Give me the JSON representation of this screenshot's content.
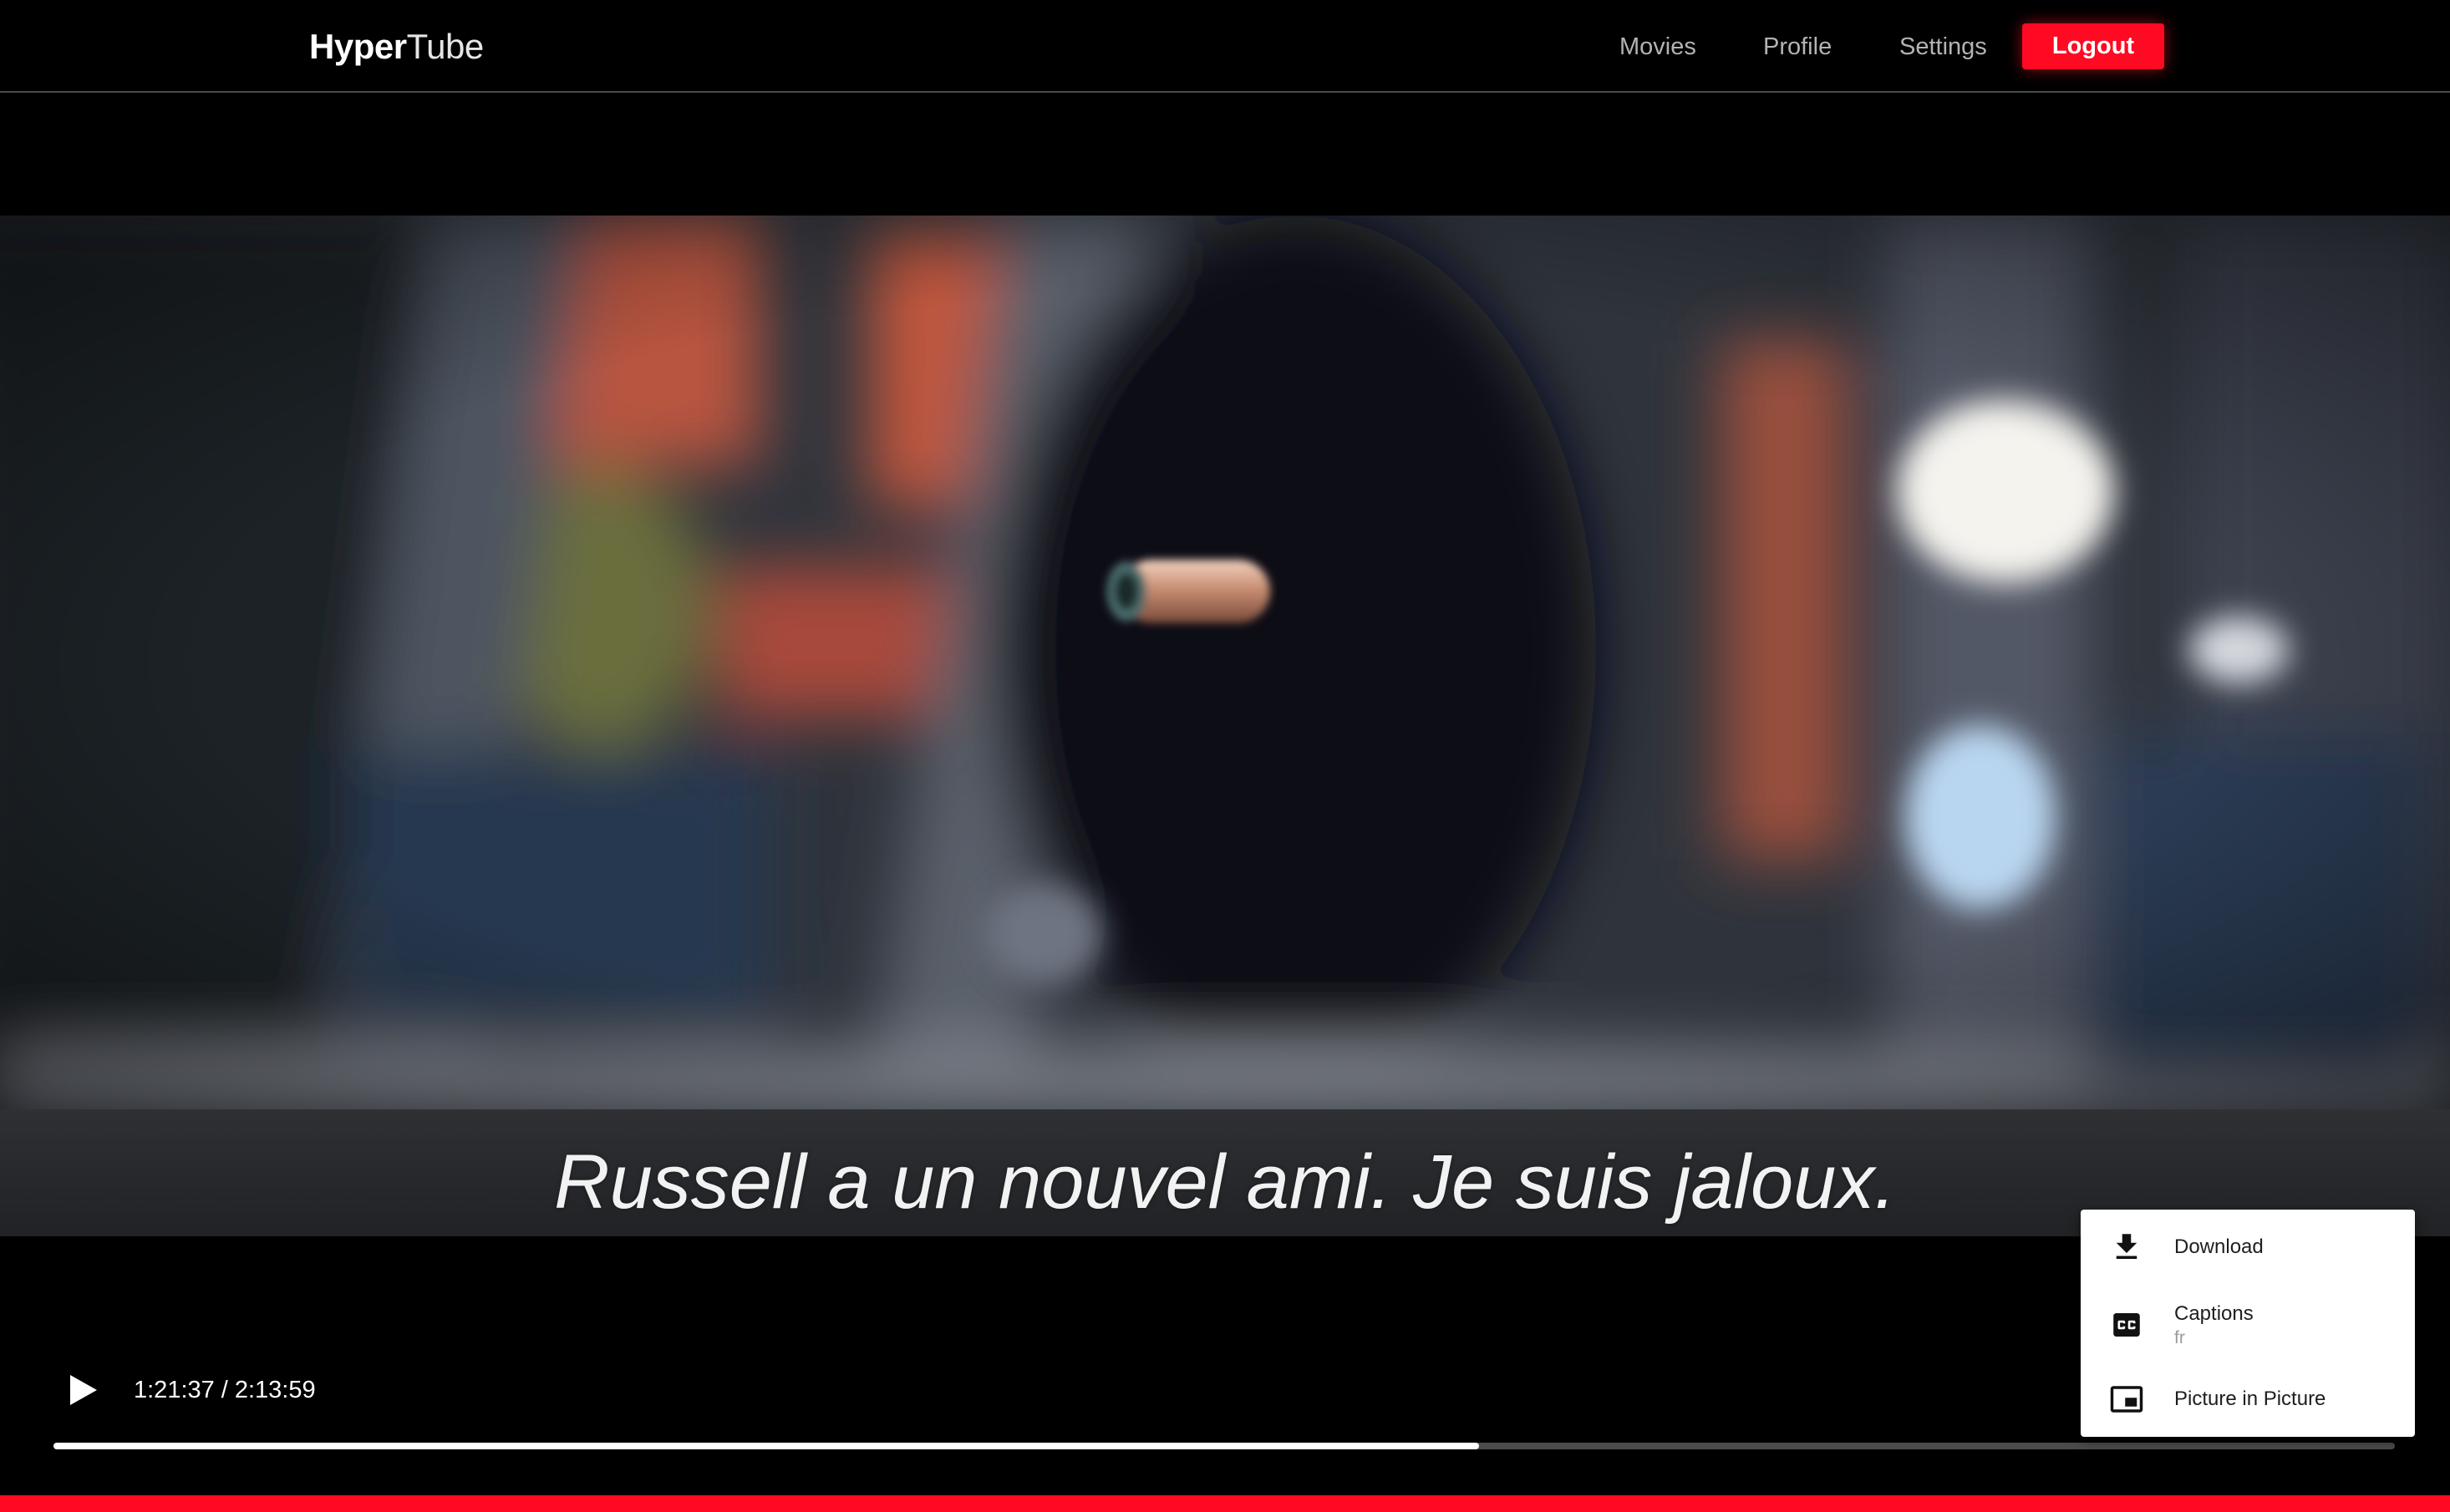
{
  "navbar": {
    "brand_bold": "Hyper",
    "brand_light": "Tube",
    "links": {
      "movies": "Movies",
      "profile": "Profile",
      "settings": "Settings"
    },
    "logout_label": "Logout"
  },
  "player": {
    "subtitle": "Russell a un nouvel ami. Je suis jaloux.",
    "current_time": "1:21:37",
    "separator": "/",
    "duration": "2:13:59",
    "progress_fraction": 0.609
  },
  "menu": {
    "download_label": "Download",
    "captions_label": "Captions",
    "captions_value": "fr",
    "pip_label": "Picture in Picture"
  },
  "icons": {
    "play": "play-icon",
    "download": "download-icon",
    "captions": "closed-captions-icon",
    "pip": "picture-in-picture-icon"
  },
  "colors": {
    "accent": "#ff0a22",
    "background": "#000000",
    "nav_link": "#b3b3b3",
    "progress_played": "#ffffff",
    "progress_track": "#4b4b4b"
  }
}
